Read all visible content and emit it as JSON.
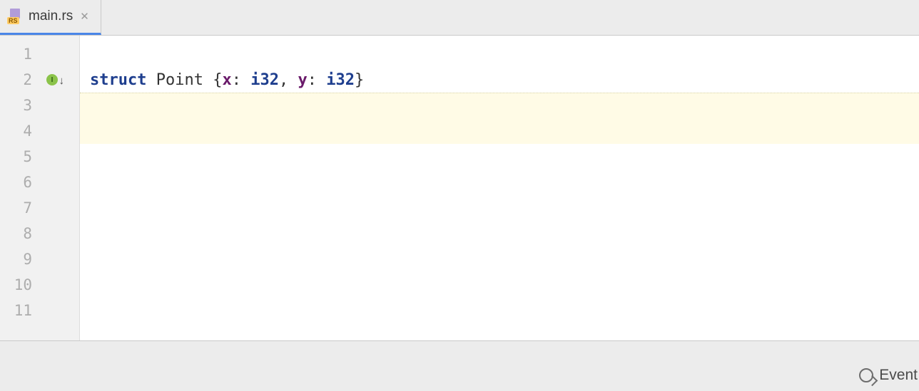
{
  "tab": {
    "filename": "main.rs",
    "file_icon_badge": "RS"
  },
  "gutter": {
    "lines": [
      "1",
      "2",
      "3",
      "4",
      "5",
      "6",
      "7",
      "8",
      "9",
      "10",
      "11"
    ],
    "impl_marker_line": 2
  },
  "code": {
    "lines": [
      {
        "tokens": []
      },
      {
        "tokens": [
          {
            "t": "struct",
            "c": "kw"
          },
          {
            "t": " ",
            "c": ""
          },
          {
            "t": "Point",
            "c": "ty"
          },
          {
            "t": " ",
            "c": ""
          },
          {
            "t": "{",
            "c": "punct"
          },
          {
            "t": "x",
            "c": "field"
          },
          {
            "t": ": ",
            "c": "punct"
          },
          {
            "t": "i32",
            "c": "prim"
          },
          {
            "t": ", ",
            "c": "punct"
          },
          {
            "t": "y",
            "c": "field"
          },
          {
            "t": ": ",
            "c": "punct"
          },
          {
            "t": "i32",
            "c": "prim"
          },
          {
            "t": "}",
            "c": "punct"
          }
        ]
      },
      {
        "tokens": []
      },
      {
        "tokens": []
      },
      {
        "tokens": []
      },
      {
        "tokens": []
      },
      {
        "tokens": []
      },
      {
        "tokens": []
      },
      {
        "tokens": []
      },
      {
        "tokens": []
      },
      {
        "tokens": []
      }
    ],
    "highlighted_lines": [
      3,
      4
    ],
    "intention_bulb_line": 3
  },
  "status": {
    "event_log_label": "Event"
  }
}
